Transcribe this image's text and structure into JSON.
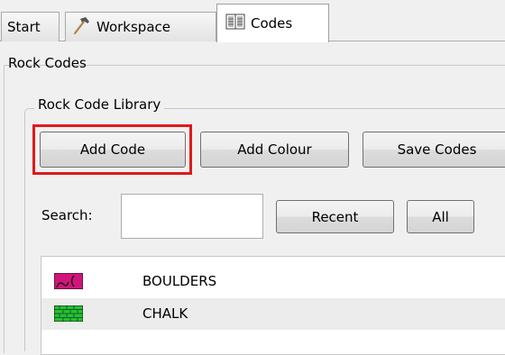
{
  "tabs": [
    {
      "label": "Start",
      "icon": ""
    },
    {
      "label": "Workspace",
      "icon": "hammer-icon"
    },
    {
      "label": "Codes",
      "icon": "book-icon",
      "active": true
    }
  ],
  "rock_codes": {
    "group_title": "Rock Codes",
    "library": {
      "group_title": "Rock Code Library",
      "buttons": {
        "add_code": "Add Code",
        "add_colour": "Add Colour",
        "save_codes": "Save Codes"
      },
      "highlight_color": "#e0191c",
      "search": {
        "label": "Search:",
        "value": "",
        "recent_label": "Recent",
        "all_label": "All"
      },
      "codes": [
        {
          "name": "BOULDERS",
          "color": "#d0157a",
          "icon": "boulders-pattern-icon"
        },
        {
          "name": "CHALK",
          "color": "#2bbf2b",
          "icon": "chalk-pattern-icon"
        }
      ]
    }
  }
}
